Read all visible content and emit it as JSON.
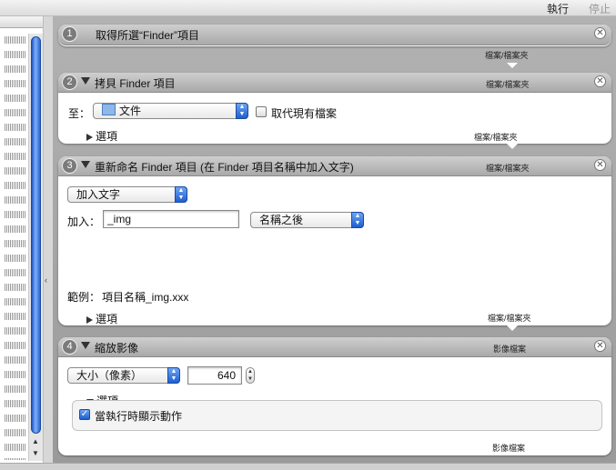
{
  "toolbar": {
    "run_label": "執行",
    "stop_label": "停止"
  },
  "actions": [
    {
      "number": "1",
      "title": "取得所選“Finder”項目",
      "output": "檔案/檔案夾"
    },
    {
      "number": "2",
      "title": "拷貝 Finder 項目",
      "input": "檔案/檔案夾",
      "output": "檔案/檔案夾",
      "to_label": "至：",
      "destination": "文件",
      "replace_label": "取代現有檔案",
      "options_label": "選項"
    },
    {
      "number": "3",
      "title": "重新命名 Finder 項目 (在 Finder 項目名稱中加入文字)",
      "input": "檔案/檔案夾",
      "output": "檔案/檔案夾",
      "mode": "加入文字",
      "add_label": "加入：",
      "add_value": "_img",
      "position": "名稱之後",
      "example_label": "範例：",
      "example_value": "項目名稱_img.xxx",
      "options_label": "選項"
    },
    {
      "number": "4",
      "title": "縮放影像",
      "input": "影像檔案",
      "output": "影像檔案",
      "size_mode": "大小（像素）",
      "size_value": "640",
      "options_label": "選項",
      "show_on_run_label": "當執行時顯示動作",
      "show_on_run": true
    }
  ],
  "colors": {
    "accent": "#1e5fd0",
    "header": "#b9b9b9",
    "background": "#9b9b9b"
  }
}
